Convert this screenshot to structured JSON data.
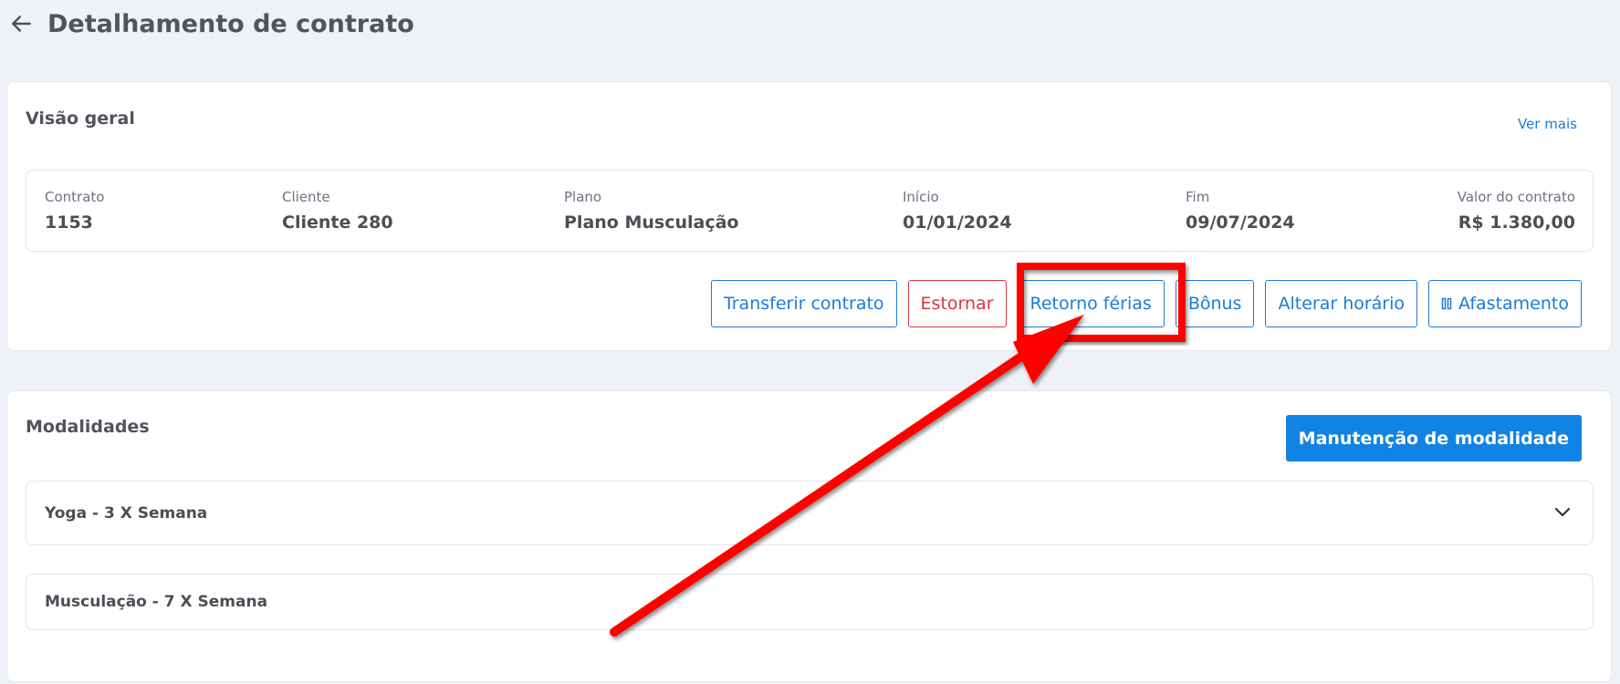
{
  "header": {
    "title": "Detalhamento de contrato",
    "back_icon": "arrow-left-icon"
  },
  "overview": {
    "title": "Visão geral",
    "ver_mais": "Ver mais",
    "fields": [
      {
        "label": "Contrato",
        "value": "1153"
      },
      {
        "label": "Cliente",
        "value": "Cliente 280"
      },
      {
        "label": "Plano",
        "value": "Plano Musculação"
      },
      {
        "label": "Início",
        "value": "01/01/2024"
      },
      {
        "label": "Fim",
        "value": "09/07/2024"
      },
      {
        "label": "Valor do contrato",
        "value": "R$ 1.380,00"
      }
    ],
    "actions": {
      "transferir": "Transferir contrato",
      "estornar": "Estornar",
      "retorno_ferias": "Retorno férias",
      "bonus": "Bônus",
      "alterar_horario": "Alterar horário",
      "afastamento": "Afastamento"
    }
  },
  "modalidades": {
    "title": "Modalidades",
    "manutencao_button": "Manutenção de modalidade",
    "items": [
      {
        "label": "Yoga - 3 X Semana"
      },
      {
        "label": "Musculação - 7 X Semana"
      }
    ]
  },
  "colors": {
    "accent": "#1f7ad6",
    "primary_button": "#1183e4",
    "danger": "#d93545",
    "annotation": "#ff0000",
    "background": "#eef1f6"
  },
  "icons": {
    "afastamento": "pause-icon",
    "expand": "chevron-down-icon"
  }
}
